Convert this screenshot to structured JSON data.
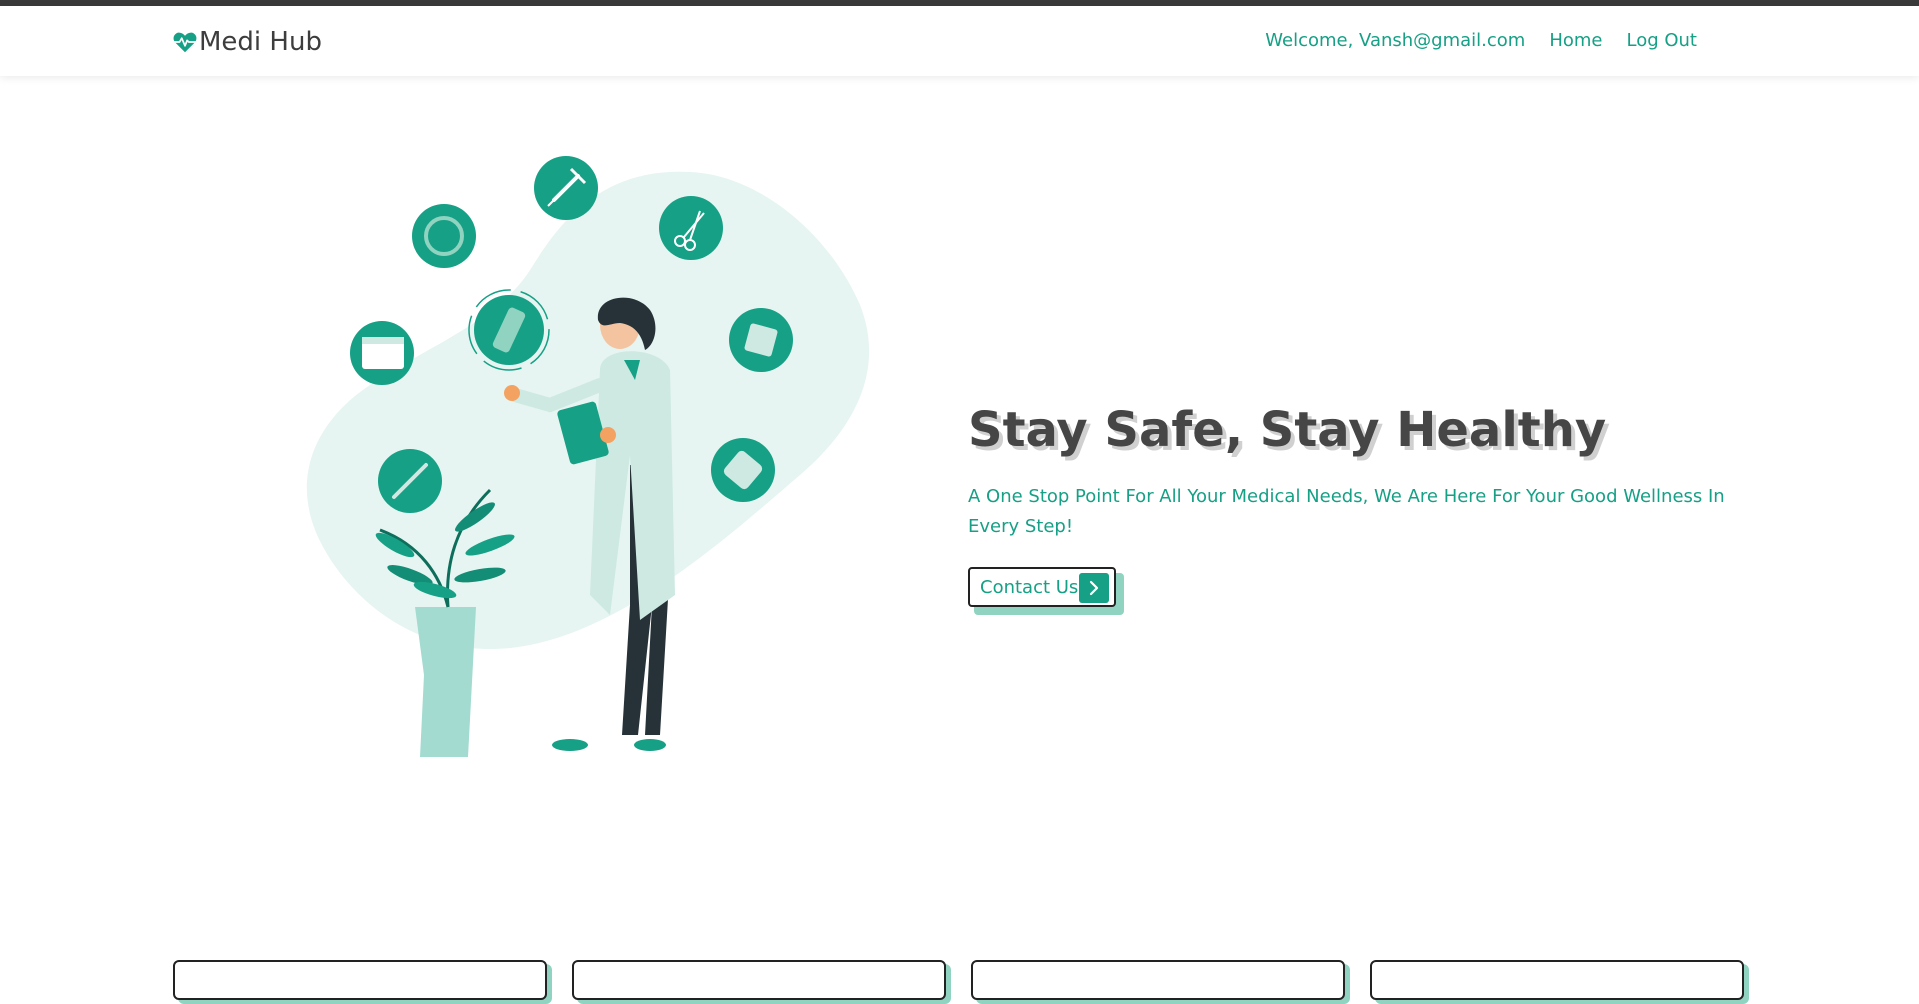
{
  "brand": {
    "name": "Medi Hub",
    "icon": "heart-pulse-icon"
  },
  "nav": {
    "welcome": "Welcome, Vansh@gmail.com",
    "home": "Home",
    "logout": "Log Out"
  },
  "hero": {
    "title": "Stay Safe, Stay Healthy",
    "subtitle": "A One Stop Point For All Your Medical Needs, We Are Here For Your Good Wellness In Every Step!",
    "cta_label": "Contact Us",
    "cta_icon": "chevron-right-icon"
  },
  "colors": {
    "accent": "#16a085",
    "accent_light": "#8fd3c0",
    "blob": "#e6f5f1",
    "heading": "#464646",
    "top_strip": "#3a3a3a"
  }
}
